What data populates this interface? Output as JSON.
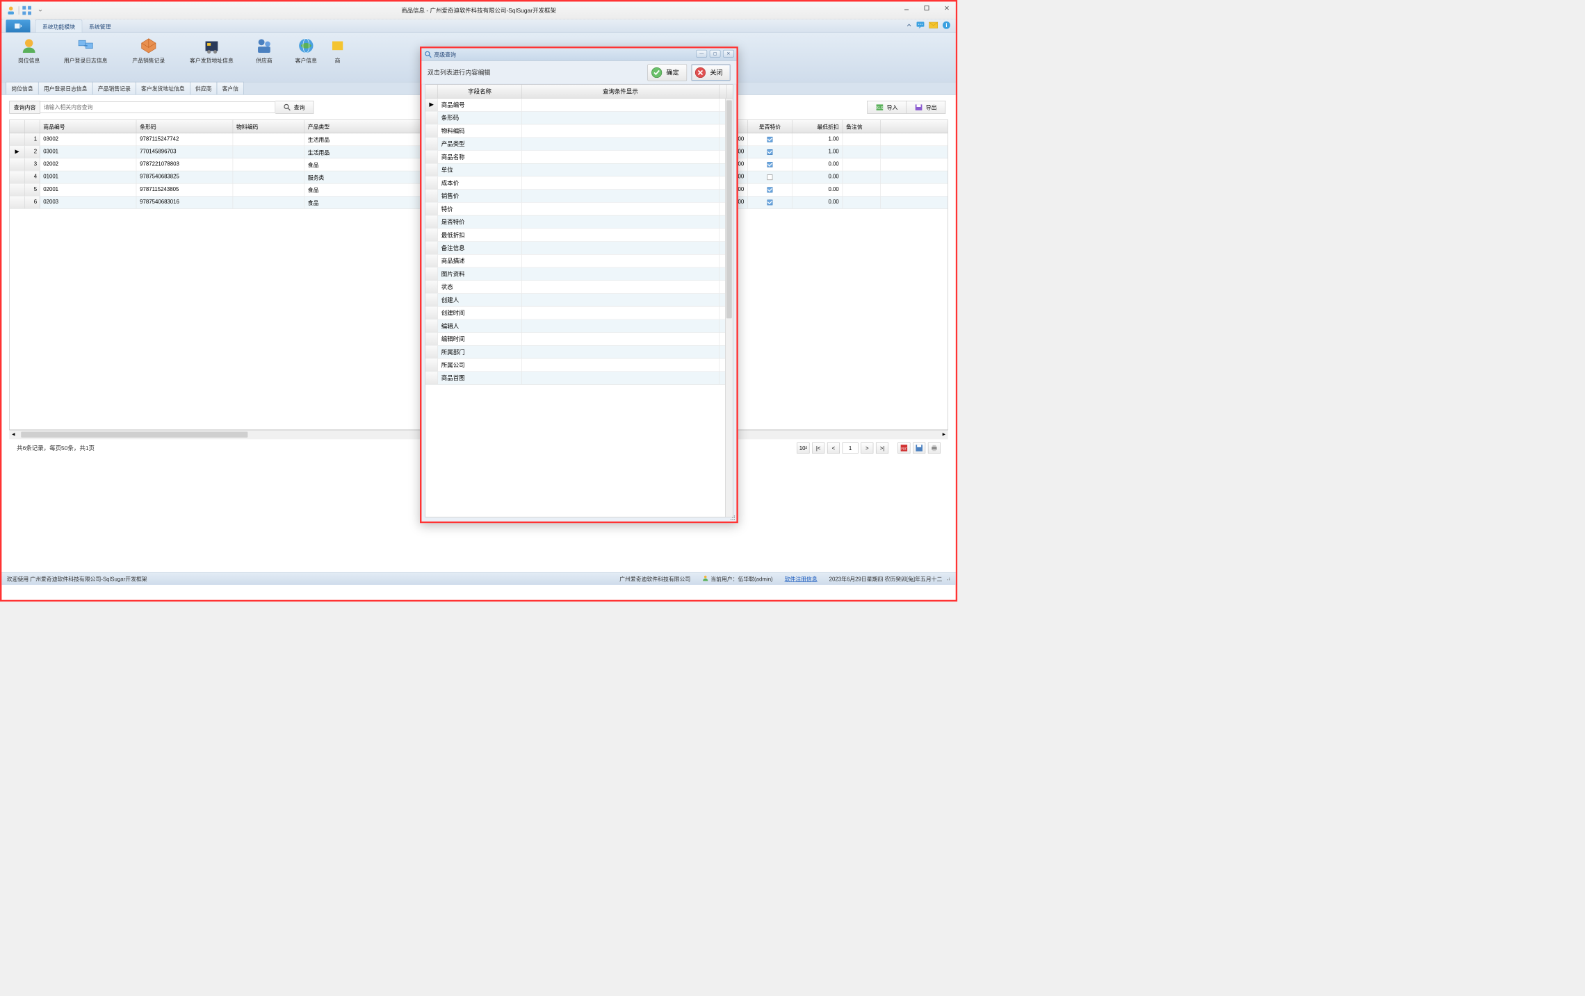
{
  "title": "商品信息 - 广州爱奇迪软件科技有限公司-SqlSugar开发框架",
  "ribbon_tabs": {
    "t1": "系统功能模块",
    "t2": "系统管理"
  },
  "ribbon_items": {
    "i1": "岗位信息",
    "i2": "用户登录日志信息",
    "i3": "产品销售记录",
    "i4": "客户发货地址信息",
    "i5": "供应商",
    "i6": "客户信息",
    "i7": "商"
  },
  "ribbon_group_label": "系统功能模块",
  "doc_tabs": {
    "d1": "岗位信息",
    "d2": "用户登录日志信息",
    "d3": "产品销售记录",
    "d4": "客户发货地址信息",
    "d5": "供应商",
    "d6": "客户信"
  },
  "search": {
    "label": "查询内容",
    "placeholder": "请输入相关内容查询",
    "btn": "查询"
  },
  "action": {
    "import": "导入",
    "export": "导出"
  },
  "grid_headers": {
    "c2": "商品编号",
    "c3": "条形码",
    "c4": "物料编码",
    "c5": "产品类型",
    "c6": "",
    "c7": "是否特价",
    "c8": "最低折扣",
    "c9": "备注信"
  },
  "rows": [
    {
      "n": "1",
      "code": "03002",
      "bar": "9787115247742",
      "mat": "",
      "type": "生活用品",
      "v": "0.00",
      "sp": true,
      "min": "1.00"
    },
    {
      "n": "2",
      "code": "03001",
      "bar": "770145896703",
      "mat": "",
      "type": "生活用品",
      "v": "0.00",
      "sp": true,
      "min": "1.00",
      "sel": true
    },
    {
      "n": "3",
      "code": "02002",
      "bar": "9787221078803",
      "mat": "",
      "type": "食品",
      "v": "0.00",
      "sp": true,
      "min": "0.00"
    },
    {
      "n": "4",
      "code": "01001",
      "bar": "9787540683825",
      "mat": "",
      "type": "服务类",
      "v": "0.00",
      "sp": false,
      "min": "0.00"
    },
    {
      "n": "5",
      "code": "02001",
      "bar": "9787115243805",
      "mat": "",
      "type": "食品",
      "v": "0.00",
      "sp": true,
      "min": "0.00"
    },
    {
      "n": "6",
      "code": "02003",
      "bar": "9787540683016",
      "mat": "",
      "type": "食品",
      "v": "0.00",
      "sp": true,
      "min": "0.00"
    }
  ],
  "pager": {
    "text": "共6条记录，每页50条，共1页",
    "page": "1",
    "sup": "10²"
  },
  "status": {
    "welcome": "欢迎使用 广州爱奇迪软件科技有限公司-SqlSugar开发框架",
    "company": "广州爱奇迪软件科技有限公司",
    "user": "当前用户：伍华聪(admin)",
    "reg": "软件注册信息",
    "date": "2023年6月29日星期四 农历癸卯[兔]年五月十二"
  },
  "dialog": {
    "title": "高级查询",
    "hint": "双击列表进行内容编辑",
    "ok": "确定",
    "close": "关闭",
    "h1": "字段名称",
    "h2": "查询条件显示",
    "fields": [
      "商品编号",
      "条形码",
      "物料编码",
      "产品类型",
      "商品名称",
      "单位",
      "成本价",
      "销售价",
      "特价",
      "是否特价",
      "最低折扣",
      "备注信息",
      "商品描述",
      "图片资料",
      "状态",
      "创建人",
      "创建时间",
      "编辑人",
      "编辑时间",
      "所属部门",
      "所属公司",
      "商品首图"
    ]
  }
}
